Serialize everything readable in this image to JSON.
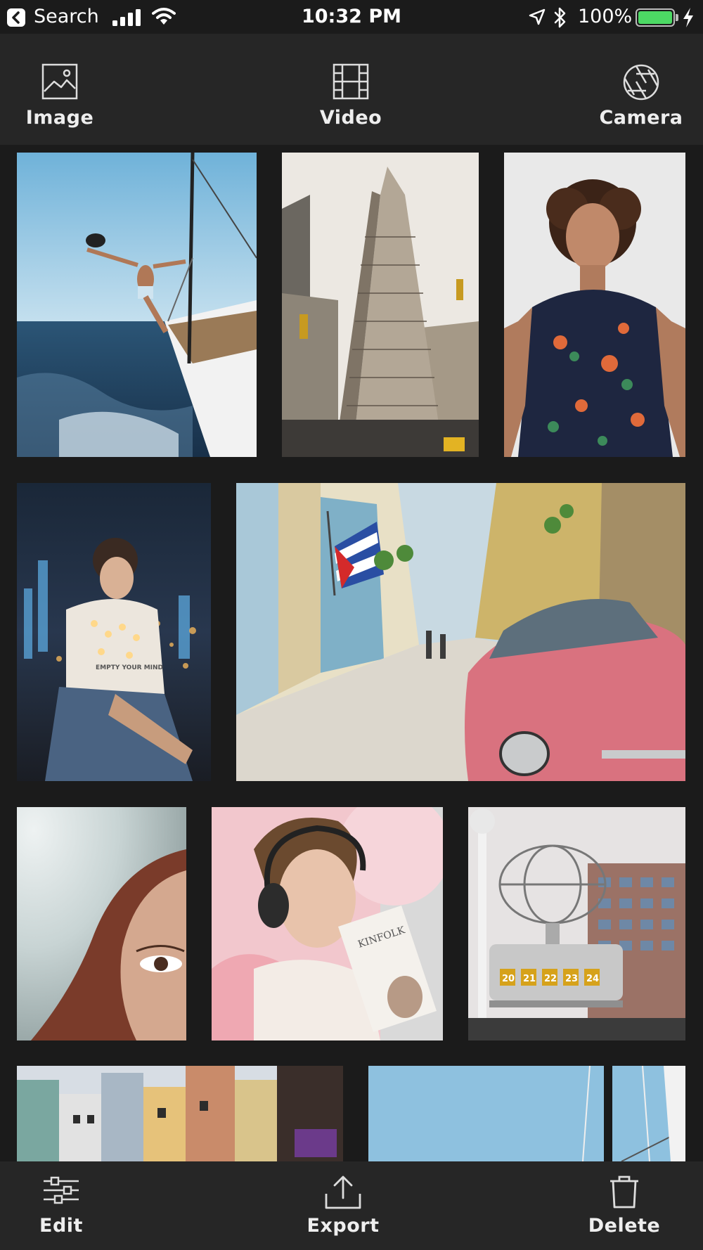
{
  "status_bar": {
    "back_app": "Search",
    "time": "10:32 PM",
    "battery_percent": "100%",
    "battery_level": 1.0,
    "signal_bars": 4,
    "icons": [
      "back-icon",
      "signal-icon",
      "wifi-icon",
      "location-icon",
      "bluetooth-icon",
      "battery-icon",
      "charging-icon"
    ]
  },
  "top_toolbar": {
    "image_label": "Image",
    "video_label": "Video",
    "camera_label": "Camera",
    "icons": [
      "image-icon",
      "video-icon",
      "camera-aperture-icon"
    ]
  },
  "gallery": {
    "photos": [
      {
        "subject": "man leaping off sailboat over sea"
      },
      {
        "subject": "flatiron building"
      },
      {
        "subject": "woman with curly hair in floral dress"
      },
      {
        "subject": "woman with fairy lights at night city"
      },
      {
        "subject": "havana street with pink classic car and cuban flag"
      },
      {
        "subject": "blurred close-up of woman's face"
      },
      {
        "subject": "woman with headphones holding magazine"
      },
      {
        "subject": "berlin world clock and tv tower"
      },
      {
        "subject": "colorful city street"
      },
      {
        "subject": "sailboat mast against blue sky"
      }
    ],
    "photo_text": [
      "EMPTY YOUR MIND",
      "KINFOLK",
      "20",
      "21",
      "22",
      "23",
      "24"
    ]
  },
  "bottom_toolbar": {
    "edit_label": "Edit",
    "export_label": "Export",
    "delete_label": "Delete",
    "icons": [
      "sliders-icon",
      "share-icon",
      "trash-icon"
    ]
  },
  "colors": {
    "background": "#1b1b1b",
    "toolbar": "#262626",
    "text": "#ffffff",
    "battery": "#4cd964"
  }
}
